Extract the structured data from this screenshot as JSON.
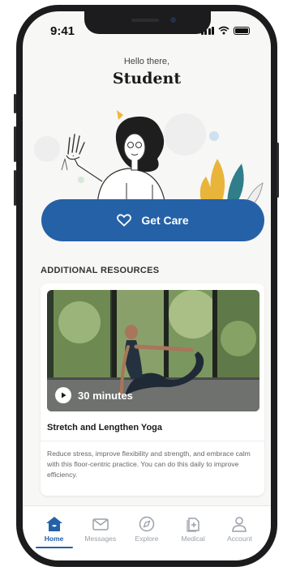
{
  "status": {
    "time": "9:41"
  },
  "header": {
    "greeting": "Hello there,",
    "name": "Student"
  },
  "cta": {
    "label": "Get Care"
  },
  "resources": {
    "section_title": "ADDITIONAL RESOURCES",
    "card": {
      "duration": "30 minutes",
      "title": "Stretch and Lengthen Yoga",
      "description": "Reduce stress, improve flexibility and strength, and embrace calm with this floor-centric practice. You can do this daily to improve efficiency."
    }
  },
  "tabs": [
    {
      "label": "Home",
      "icon": "home-icon",
      "active": true
    },
    {
      "label": "Messages",
      "icon": "mail-icon",
      "active": false
    },
    {
      "label": "Explore",
      "icon": "compass-icon",
      "active": false
    },
    {
      "label": "Medical",
      "icon": "medical-file-icon",
      "active": false
    },
    {
      "label": "Account",
      "icon": "user-icon",
      "active": false
    }
  ],
  "colors": {
    "accent": "#2561a7",
    "background": "#f7f7f6",
    "leaf_yellow": "#e8b43a",
    "leaf_teal": "#2f7e8a"
  }
}
